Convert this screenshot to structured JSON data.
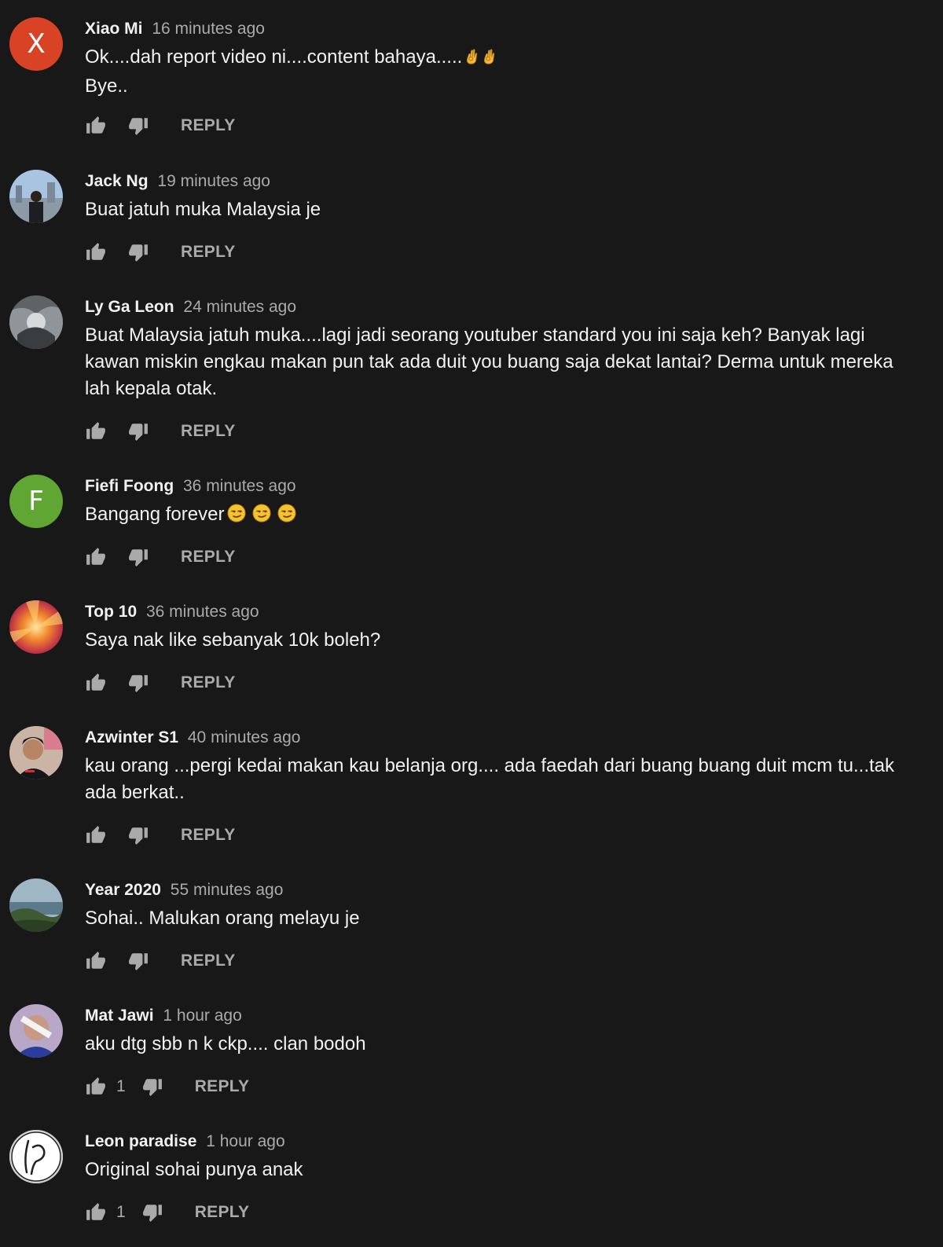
{
  "icons": {
    "like": "thumbs-up-icon",
    "dislike": "thumbs-down-icon"
  },
  "colors": {
    "background": "#181818",
    "text": "#f1f1f1",
    "muted": "#aaaaaa"
  },
  "comments": [
    {
      "author": "Xiao Mi",
      "time": "16 minutes ago",
      "avatar_letter": "X",
      "avatar_color": "#d84326",
      "lines": [
        "Ok....dah report video ni....content bahaya.....",
        "Bye.."
      ],
      "reply_label": "REPLY"
    },
    {
      "author": "Jack Ng",
      "time": "19 minutes ago",
      "lines": [
        "Buat jatuh muka Malaysia je"
      ],
      "reply_label": "REPLY"
    },
    {
      "author": "Ly Ga Leon",
      "time": "24 minutes ago",
      "lines": [
        "Buat Malaysia jatuh muka....lagi jadi seorang youtuber standard you ini saja keh? Banyak lagi",
        "kawan miskin engkau makan pun tak ada duit you buang saja dekat lantai? Derma untuk mereka",
        "lah kepala otak."
      ],
      "reply_label": "REPLY"
    },
    {
      "author": "Fiefi Foong",
      "time": "36 minutes ago",
      "avatar_letter": "F",
      "avatar_color": "#5fa632",
      "lines": [
        "Bangang forever"
      ],
      "reply_label": "REPLY"
    },
    {
      "author": "Top 10",
      "time": "36 minutes ago",
      "lines": [
        "Saya nak like sebanyak 10k boleh?"
      ],
      "reply_label": "REPLY"
    },
    {
      "author": "Azwinter S1",
      "time": "40 minutes ago",
      "lines": [
        "kau orang ...pergi kedai makan kau belanja org.... ada faedah dari buang buang duit mcm tu...tak",
        "ada berkat.."
      ],
      "reply_label": "REPLY"
    },
    {
      "author": "Year 2020",
      "time": "55 minutes ago",
      "lines": [
        "Sohai.. Malukan orang melayu je"
      ],
      "reply_label": "REPLY"
    },
    {
      "author": "Mat Jawi",
      "time": "1 hour ago",
      "lines": [
        "aku dtg sbb n k ckp.... clan bodoh"
      ],
      "like_count": "1",
      "reply_label": "REPLY"
    },
    {
      "author": "Leon paradise",
      "time": "1 hour ago",
      "lines": [
        "Original sohai punya anak"
      ],
      "like_count": "1",
      "reply_label": "REPLY"
    }
  ]
}
